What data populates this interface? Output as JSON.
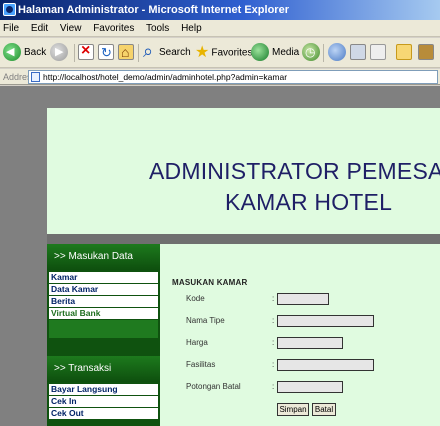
{
  "window": {
    "title": "Halaman Administrator - Microsoft Internet Explorer"
  },
  "menu": {
    "items": [
      "File",
      "Edit",
      "View",
      "Favorites",
      "Tools",
      "Help"
    ]
  },
  "toolbar": {
    "back_label": "Back",
    "search_label": "Search",
    "favorites_label": "Favorites",
    "media_label": "Media"
  },
  "address": {
    "label": "Address",
    "url": "http://localhost/hotel_demo/admin/adminhotel.php?admin=kamar"
  },
  "header": {
    "line1": "ADMINISTRATOR PEMESANAN",
    "line2": "KAMAR HOTEL"
  },
  "sidebar": {
    "section1_heading": ">> Masukan Data",
    "section1_items": [
      "Kamar",
      "Data Kamar",
      "Berita",
      "Virtual Bank"
    ],
    "section2_heading": ">> Transaksi",
    "section2_items": [
      "Bayar Langsung",
      "Cek In",
      "Cek Out"
    ]
  },
  "form": {
    "title": "MASUKAN KAMAR",
    "fields": [
      {
        "label": "Kode",
        "value": ""
      },
      {
        "label": "Nama Tipe",
        "value": ""
      },
      {
        "label": "Harga",
        "value": ""
      },
      {
        "label": "Fasilitas",
        "value": ""
      },
      {
        "label": "Potongan Batal",
        "value": ""
      }
    ],
    "separator": ":",
    "save_label": "Simpan",
    "cancel_label": "Batal"
  },
  "colors": {
    "titlebar": "#0a246a",
    "header_bg": "#e0fbe0",
    "sidebar_bg": "#0f520f",
    "header_text": "#1f1f66"
  }
}
